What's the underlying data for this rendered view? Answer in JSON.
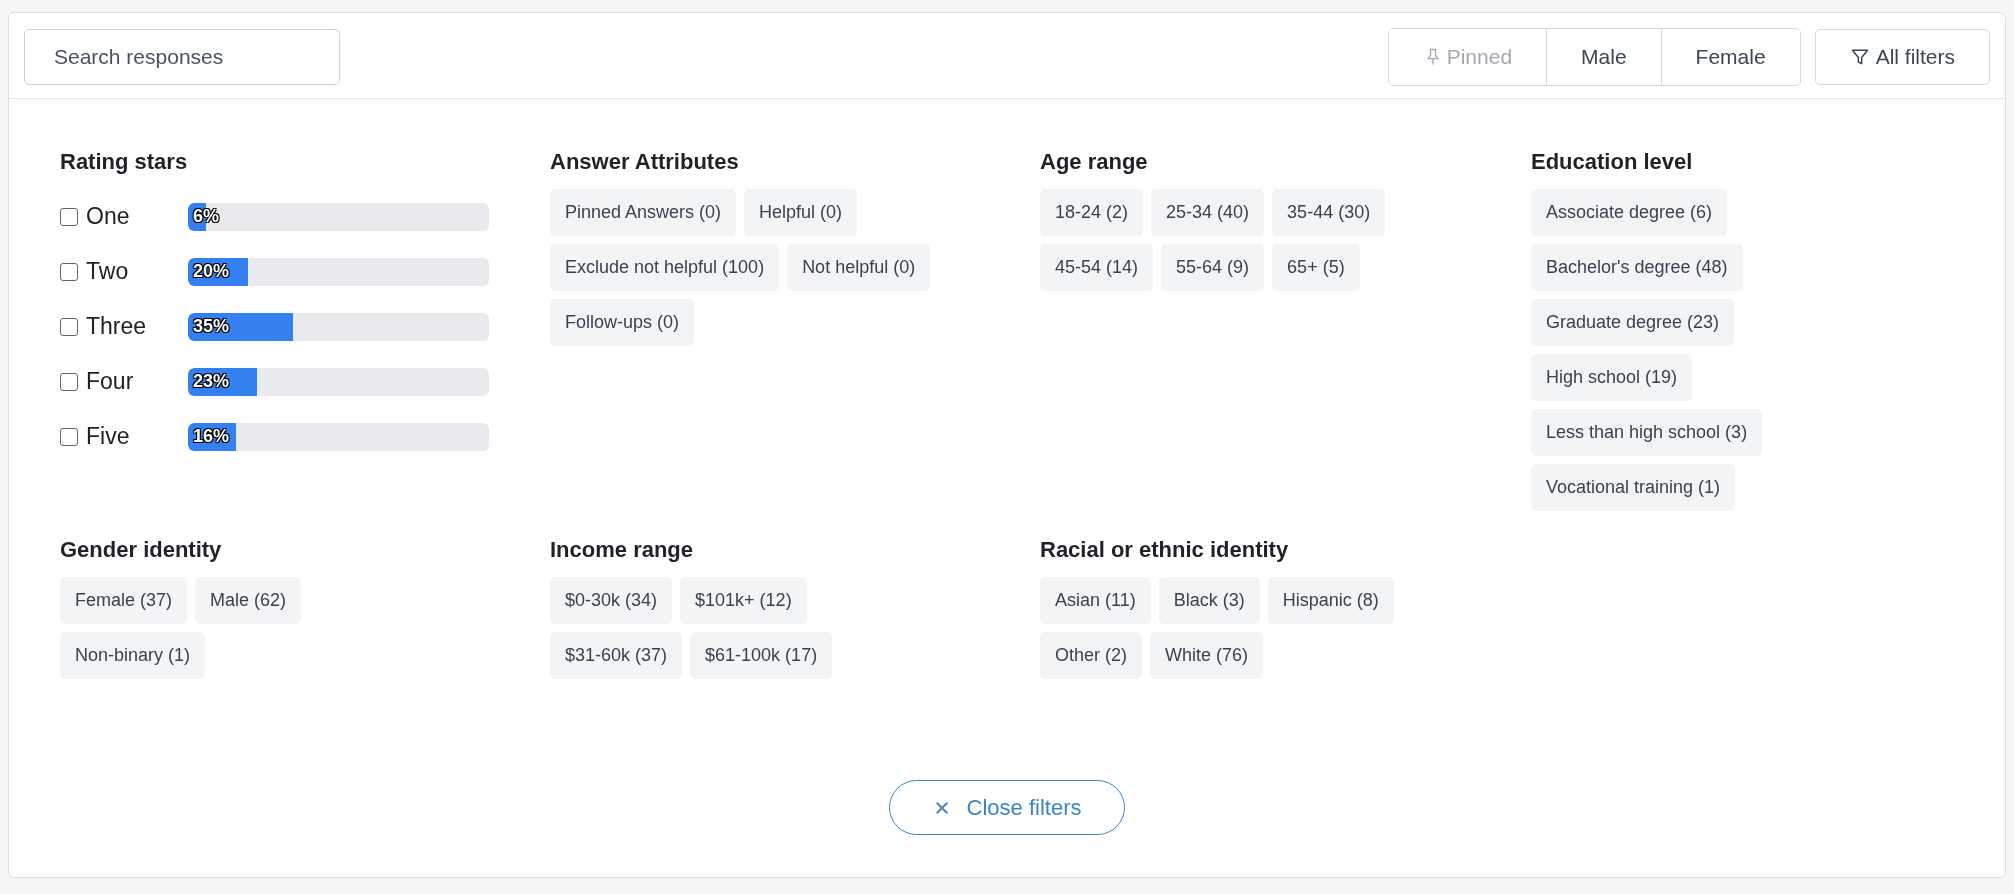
{
  "search": {
    "placeholder": "Search responses"
  },
  "segments": [
    {
      "label": "Pinned",
      "kind": "pinned",
      "disabled": true
    },
    {
      "label": "Male",
      "kind": "plain",
      "disabled": false
    },
    {
      "label": "Female",
      "kind": "plain",
      "disabled": false
    }
  ],
  "all_filters": {
    "label": "All filters"
  },
  "sections": [
    {
      "title": "Rating stars",
      "kind": "bars",
      "items": [
        {
          "label": "One",
          "checked": false,
          "level": 0.06,
          "reading": "6%"
        },
        {
          "label": "Two",
          "checked": false,
          "level": 0.2,
          "reading": "20%"
        },
        {
          "label": "Three",
          "checked": false,
          "level": 0.35,
          "reading": "35%"
        },
        {
          "label": "Four",
          "checked": false,
          "level": 0.23,
          "reading": "23%"
        },
        {
          "label": "Five",
          "checked": false,
          "level": 0.16,
          "reading": "16%"
        }
      ]
    },
    {
      "title": "Answer Attributes",
      "kind": "chips",
      "items": [
        "Pinned Answers (0)",
        "Helpful (0)",
        "Exclude not helpful (100)",
        "Not helpful (0)",
        "Follow-ups (0)"
      ]
    },
    {
      "title": "Age range",
      "kind": "chips",
      "items": [
        "18-24 (2)",
        "25-34 (40)",
        "35-44 (30)",
        "45-54 (14)",
        "55-64 (9)",
        "65+ (5)"
      ]
    },
    {
      "title": "Education level",
      "kind": "chip-column",
      "items": [
        "Associate degree (6)",
        "Bachelor's degree (48)",
        "Graduate degree (23)",
        "High school (19)",
        "Less than high school (3)",
        "Vocational training (1)"
      ]
    },
    {
      "title": "Gender identity",
      "kind": "chips",
      "items": [
        "Female (37)",
        "Male (62)",
        "Non-binary (1)"
      ]
    },
    {
      "title": "Income range",
      "kind": "chips",
      "items": [
        "$0-30k (34)",
        "$101k+ (12)",
        "$31-60k (37)",
        "$61-100k (17)"
      ]
    },
    {
      "title": "Racial or ethnic identity",
      "kind": "chips",
      "items": [
        "Asian (11)",
        "Black (3)",
        "Hispanic (8)",
        "Other (2)",
        "White (76)"
      ]
    }
  ],
  "close_button": {
    "label": "Close filters"
  }
}
